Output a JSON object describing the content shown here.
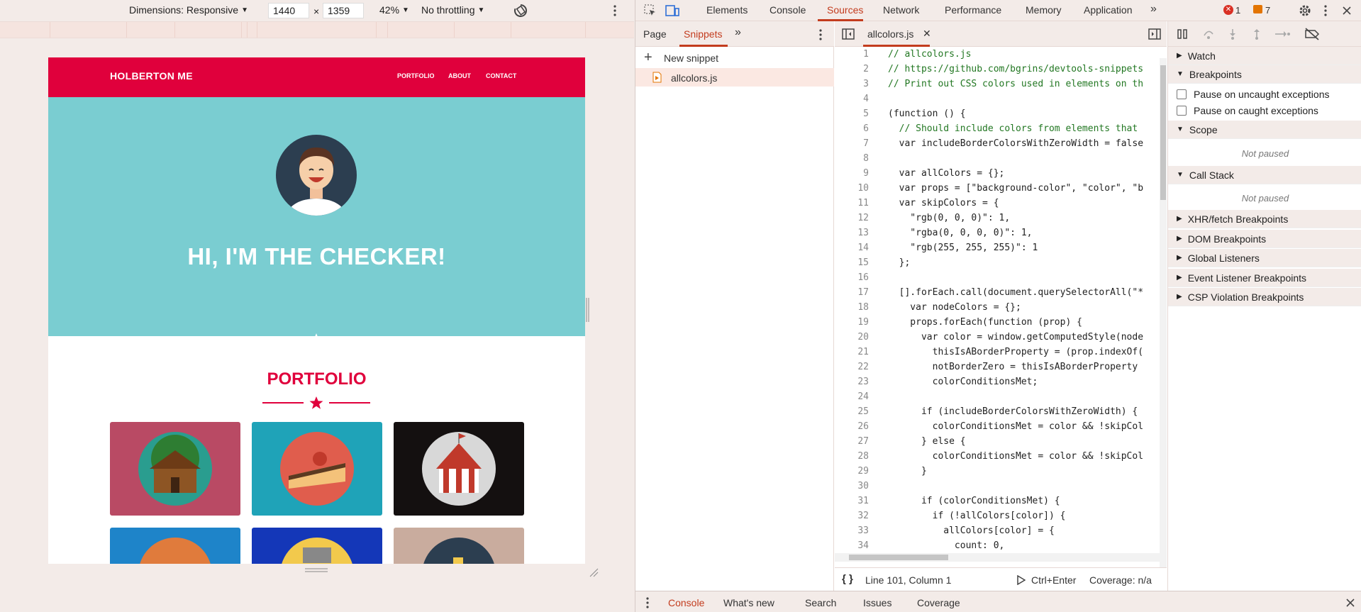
{
  "device_toolbar": {
    "dimensions_label": "Dimensions: Responsive",
    "width": "1440",
    "times": "×",
    "height": "1359",
    "zoom": "42%",
    "throttling": "No throttling"
  },
  "site": {
    "logo": "HOLBERTON ME",
    "nav": [
      "PORTFOLIO",
      "ABOUT",
      "CONTACT"
    ],
    "hero_title": "HI, I'M THE CHECKER!",
    "portfolio_title": "PORTFOLIO",
    "colors": {
      "nav": "#e0003c",
      "hero": "#7acdd1",
      "accent": "#e0003c"
    }
  },
  "devtools": {
    "tabs": [
      "Elements",
      "Console",
      "Sources",
      "Network",
      "Performance",
      "Memory",
      "Application"
    ],
    "active_tab": "Sources",
    "error_count": "1",
    "message_count": "7",
    "nav_tabs": [
      "Page",
      "Snippets"
    ],
    "new_snippet": "New snippet",
    "snippet_file": "allcolors.js",
    "editor_tab": "allcolors.js",
    "status": {
      "position": "Line 101, Column 1",
      "run_shortcut": "Ctrl+Enter",
      "coverage": "Coverage: n/a"
    },
    "debugger": {
      "watch": "Watch",
      "breakpoints": "Breakpoints",
      "pause_uncaught": "Pause on uncaught exceptions",
      "pause_caught": "Pause on caught exceptions",
      "scope": "Scope",
      "not_paused_1": "Not paused",
      "call_stack": "Call Stack",
      "not_paused_2": "Not paused",
      "xhr": "XHR/fetch Breakpoints",
      "dom": "DOM Breakpoints",
      "global": "Global Listeners",
      "event": "Event Listener Breakpoints",
      "csp": "CSP Violation Breakpoints"
    },
    "drawer_tabs": [
      "Console",
      "What's new",
      "Search",
      "Issues",
      "Coverage"
    ]
  },
  "code_lines": [
    {
      "n": "1",
      "t": "// allcolors.js"
    },
    {
      "n": "2",
      "t": "// https://github.com/bgrins/devtools-snippets"
    },
    {
      "n": "3",
      "t": "// Print out CSS colors used in elements on th"
    },
    {
      "n": "4",
      "t": ""
    },
    {
      "n": "5",
      "t": "(function () {"
    },
    {
      "n": "6",
      "t": "  // Should include colors from elements that"
    },
    {
      "n": "7",
      "t": "  var includeBorderColorsWithZeroWidth = false"
    },
    {
      "n": "8",
      "t": ""
    },
    {
      "n": "9",
      "t": "  var allColors = {};"
    },
    {
      "n": "10",
      "t": "  var props = [\"background-color\", \"color\", \"b"
    },
    {
      "n": "11",
      "t": "  var skipColors = {"
    },
    {
      "n": "12",
      "t": "    \"rgb(0, 0, 0)\": 1,"
    },
    {
      "n": "13",
      "t": "    \"rgba(0, 0, 0, 0)\": 1,"
    },
    {
      "n": "14",
      "t": "    \"rgb(255, 255, 255)\": 1"
    },
    {
      "n": "15",
      "t": "  };"
    },
    {
      "n": "16",
      "t": ""
    },
    {
      "n": "17",
      "t": "  [].forEach.call(document.querySelectorAll(\"*"
    },
    {
      "n": "18",
      "t": "    var nodeColors = {};"
    },
    {
      "n": "19",
      "t": "    props.forEach(function (prop) {"
    },
    {
      "n": "20",
      "t": "      var color = window.getComputedStyle(node"
    },
    {
      "n": "21",
      "t": "        thisIsABorderProperty = (prop.indexOf("
    },
    {
      "n": "22",
      "t": "        notBorderZero = thisIsABorderProperty"
    },
    {
      "n": "23",
      "t": "        colorConditionsMet;"
    },
    {
      "n": "24",
      "t": ""
    },
    {
      "n": "25",
      "t": "      if (includeBorderColorsWithZeroWidth) {"
    },
    {
      "n": "26",
      "t": "        colorConditionsMet = color && !skipCol"
    },
    {
      "n": "27",
      "t": "      } else {"
    },
    {
      "n": "28",
      "t": "        colorConditionsMet = color && !skipCol"
    },
    {
      "n": "29",
      "t": "      }"
    },
    {
      "n": "30",
      "t": ""
    },
    {
      "n": "31",
      "t": "      if (colorConditionsMet) {"
    },
    {
      "n": "32",
      "t": "        if (!allColors[color]) {"
    },
    {
      "n": "33",
      "t": "          allColors[color] = {"
    },
    {
      "n": "34",
      "t": "            count: 0,"
    }
  ]
}
